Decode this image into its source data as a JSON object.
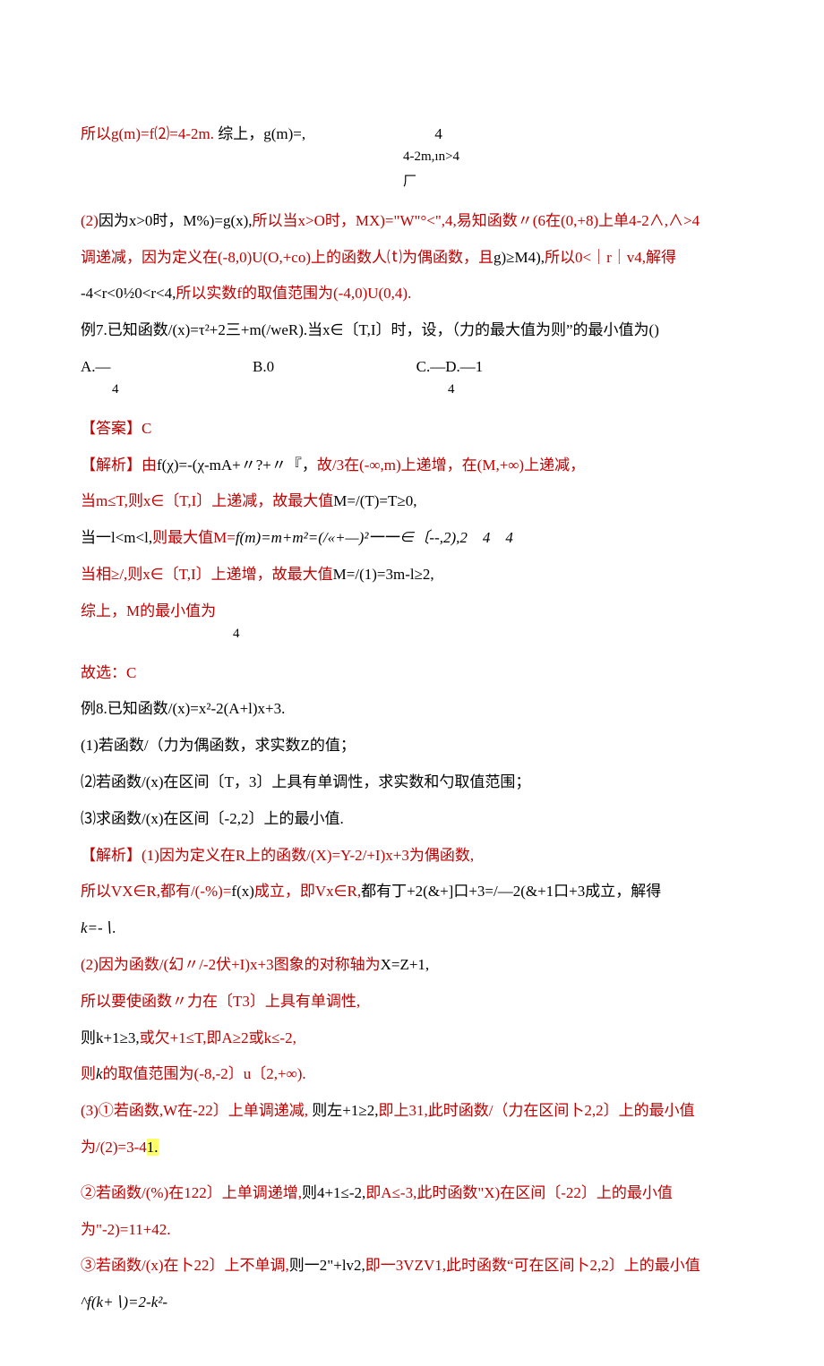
{
  "l1": {
    "a": "所以g(m)=f⑵=4-2m.",
    "b": "综上，g(m)=,",
    "c": "4"
  },
  "l1b": "4-2m,ın>4",
  "l1c": "厂",
  "l2": {
    "a": "(2)",
    "b": "因为x>0时，M%)=g(x),",
    "c": "所以当x>O时，MX)=\"W\"°<\",4,",
    "d": "易知函数〃(6在(0,+8)上单4-2∧,∧>4"
  },
  "l3": {
    "a": "调递减，因为定义在(-8,0)U(O,+co)上的函数人⒯为偶函数，且",
    "b": "g)≥M4),",
    "c": "所以0<｜r｜v4,",
    "d": "解得"
  },
  "l4": {
    "a": "-4<r<0½0<r<4,",
    "b": "所以实数f的取值范围为(-4,0)U(0,4)."
  },
  "l5": "例7.已知函数/(x)=τ²+2三+m(/weR).当x∈〔T,I〕时，设，（力的最大值为则”的最小值为()",
  "l6": {
    "a": "A.—",
    "a2": "4",
    "b": "B.0",
    "c": "C.—D.—1",
    "c2": "4"
  },
  "l7": "【答案】C",
  "l8": {
    "a": "【解析】由",
    "b": "f(χ)=-(χ-mA+〃?+〃『，",
    "c": "故/3在(-∞,m)上递增，在(M,+∞)上递减，"
  },
  "l9": {
    "a": "当m≤T,",
    "b": "则x∈〔T,I〕上递减，故最大值",
    "c": "M=/(T)=T≥0,"
  },
  "l10": {
    "a": "当一l<m<l,",
    "b": "则最大值M=",
    "c": "f(m)=m+m²=(/«+—)²一一∈〔--,2),2　4　4"
  },
  "l11": {
    "a": "当相≥/,",
    "b": "则x∈〔T,I〕上递增，故最大值",
    "c": "M=/(1)=3m-l≥2,"
  },
  "l12": {
    "a": "综上，M的最小值为",
    "b": "4"
  },
  "l13": "故选：C",
  "l14": "例8.已知函数/(x)=x²-2(A+l)x+3.",
  "l15": "(1)若函数/（力为偶函数，求实数Z的值；",
  "l16": "⑵若函数/(x)在区间〔T，3〕上具有单调性，求实数和勺取值范围；",
  "l17": "⑶求函数/(x)在区间〔-2,2〕上的最小值.",
  "l18": {
    "a": "【解析】",
    "b": "(1)因为定义在R上的函数/(X)=Y-2/+I)x+3为偶函数,"
  },
  "l19": {
    "a": "所以VX∈R,",
    "b": "都有/(-%)=",
    "c": "f(x)",
    "d": "成立，即Vx∈R,",
    "e": "都有丁+2(&+]口+3=/—2(&+1口+3成立，解得"
  },
  "l20": "k=-∖.",
  "l21": {
    "a": "(2)因为函数/(幻〃/-2伏+I)x+3图象的对称轴为",
    "b": "X=Z+1,"
  },
  "l22": "所以要使函数〃力在〔T3〕上具有单调性,",
  "l23": {
    "a": "则k+1≥3,",
    "b": "或欠+1≤T,",
    "c": "即A≥2或k≤-2,"
  },
  "l24": {
    "a": "则",
    "b": "k",
    "c": "的取值范围为(-8,-2〕u〔2,+∞)."
  },
  "l25": {
    "a": "(3)①若函数,W在-22〕上单调递减,",
    "b": "则左+1≥2,",
    "c": "即上31,",
    "d": "此时函数/（力在区间卜2,2〕上的最小值"
  },
  "l26": {
    "a": "为/(2)=3-4",
    "b": "1."
  },
  "l27": {
    "a": "②若函数/(%)在122〕上单调递增,",
    "b": "则4+1≤-2,",
    "c": "即A≤-3,",
    "d": "此时函数\"X)在区间〔-22〕上的最小值为\"-2)=11+42."
  },
  "l28": {
    "a": "③若函数/(x)在卜22〕上不单调,",
    "b": "则一2\"+lv2,",
    "c": "即一3VZV1,",
    "d": "此时函数“可在区间卜2,2〕上的最小值",
    "e": "^f(k+∖)=2-k²-"
  }
}
